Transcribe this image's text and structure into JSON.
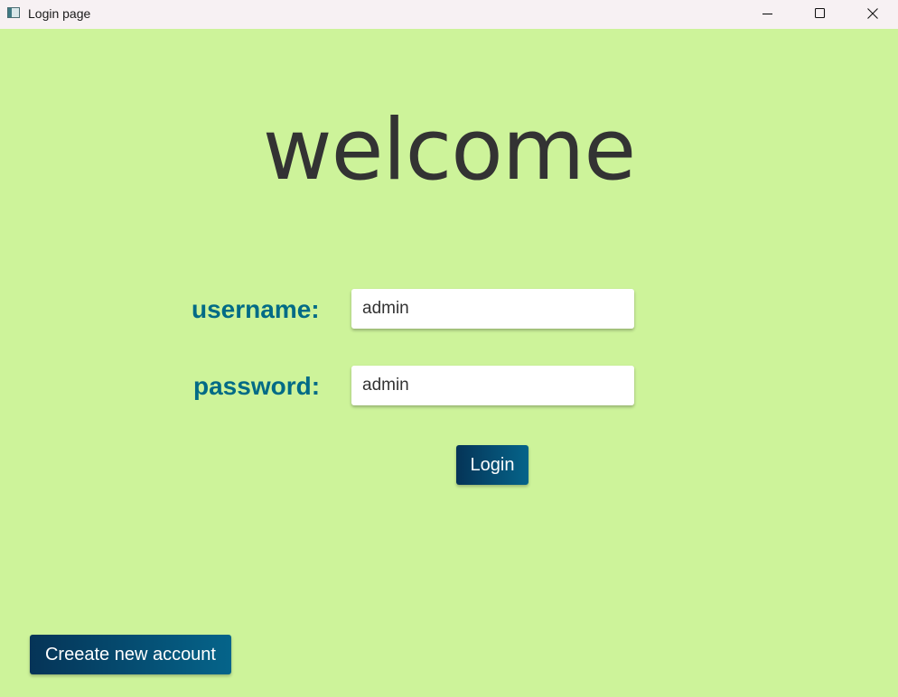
{
  "window": {
    "title": "Login page",
    "background_color": "#cdf39a",
    "controls": {
      "minimize_icon": "minimize-icon",
      "maximize_icon": "maximize-icon",
      "close_icon": "close-icon"
    }
  },
  "main": {
    "heading": "welcome",
    "username": {
      "label": "username:",
      "value": "admin"
    },
    "password": {
      "label": "password:",
      "value": "admin"
    },
    "login_button": "Login",
    "create_account_button": "Creeate new account"
  },
  "colors": {
    "label": "#016b86",
    "heading": "#333333",
    "button_gradient_start": "#053457",
    "button_gradient_end": "#05648a"
  }
}
